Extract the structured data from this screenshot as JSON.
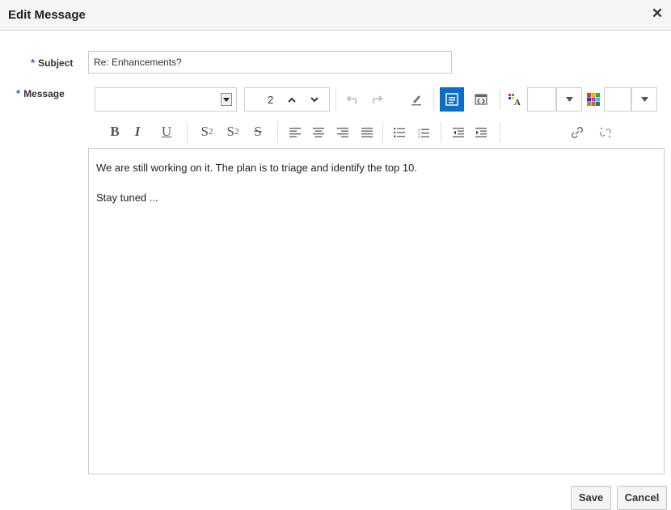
{
  "dialog": {
    "title": "Edit Message",
    "close_glyph": "✕"
  },
  "form": {
    "required_marker": "*",
    "subject_label": "Subject",
    "subject_value": "Re: Enhancements?",
    "message_label": "Message"
  },
  "toolbar": {
    "font_family_value": "",
    "font_size_value": "2",
    "icons_row1": [
      "font-family-select",
      "font-size-stepper",
      "undo-icon",
      "redo-icon",
      "clear-format-icon",
      "rich-text-mode-icon",
      "source-code-mode-icon",
      "text-color-icon",
      "background-color-icon"
    ],
    "bold_glyph": "B",
    "italic_glyph": "I",
    "underline_glyph": "U",
    "subscript_glyph": "S",
    "subscript_sub": "2",
    "superscript_glyph": "S",
    "superscript_sup": "2",
    "strike_glyph": "S",
    "accent_color": "#1a6fc4"
  },
  "editor": {
    "line1": "We are still working on it. The plan is to triage and identify the top 10.",
    "line2": "Stay tuned ..."
  },
  "actions": {
    "save_label": "Save",
    "cancel_label": "Cancel"
  }
}
